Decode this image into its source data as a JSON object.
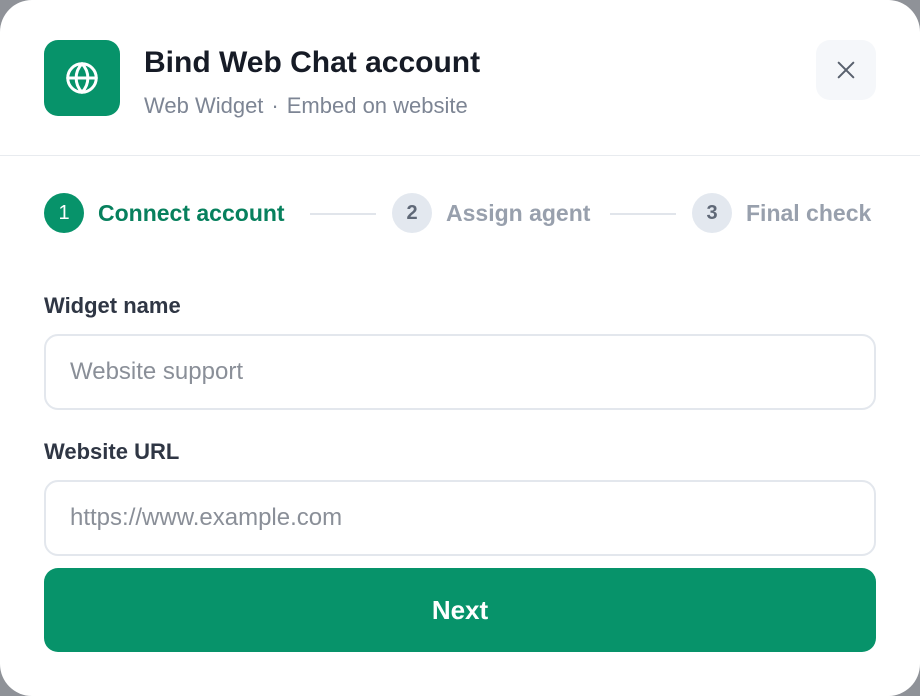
{
  "dialog": {
    "title": "Bind Web Chat account",
    "subtitle_platform": "Web Widget",
    "subtitle_separator": "·",
    "subtitle_detail": "Embed on website",
    "app_icon": "globe-icon",
    "close_icon": "close-icon"
  },
  "steps": [
    {
      "number": "1",
      "label": "Connect account",
      "state": "active"
    },
    {
      "number": "2",
      "label": "Assign agent",
      "state": "inactive"
    },
    {
      "number": "3",
      "label": "Final check",
      "state": "inactive"
    }
  ],
  "form": {
    "widget_name": {
      "label": "Widget name",
      "value": "",
      "placeholder": "Website support"
    },
    "website_url": {
      "label": "Website URL",
      "value": "",
      "placeholder": "https://www.example.com"
    }
  },
  "actions": {
    "next_label": "Next"
  },
  "colors": {
    "accent": "#07936a",
    "accent_text": "#07805d",
    "muted_step": "#e3e8ef",
    "title": "#161b26",
    "subtitle": "#7d8594"
  }
}
